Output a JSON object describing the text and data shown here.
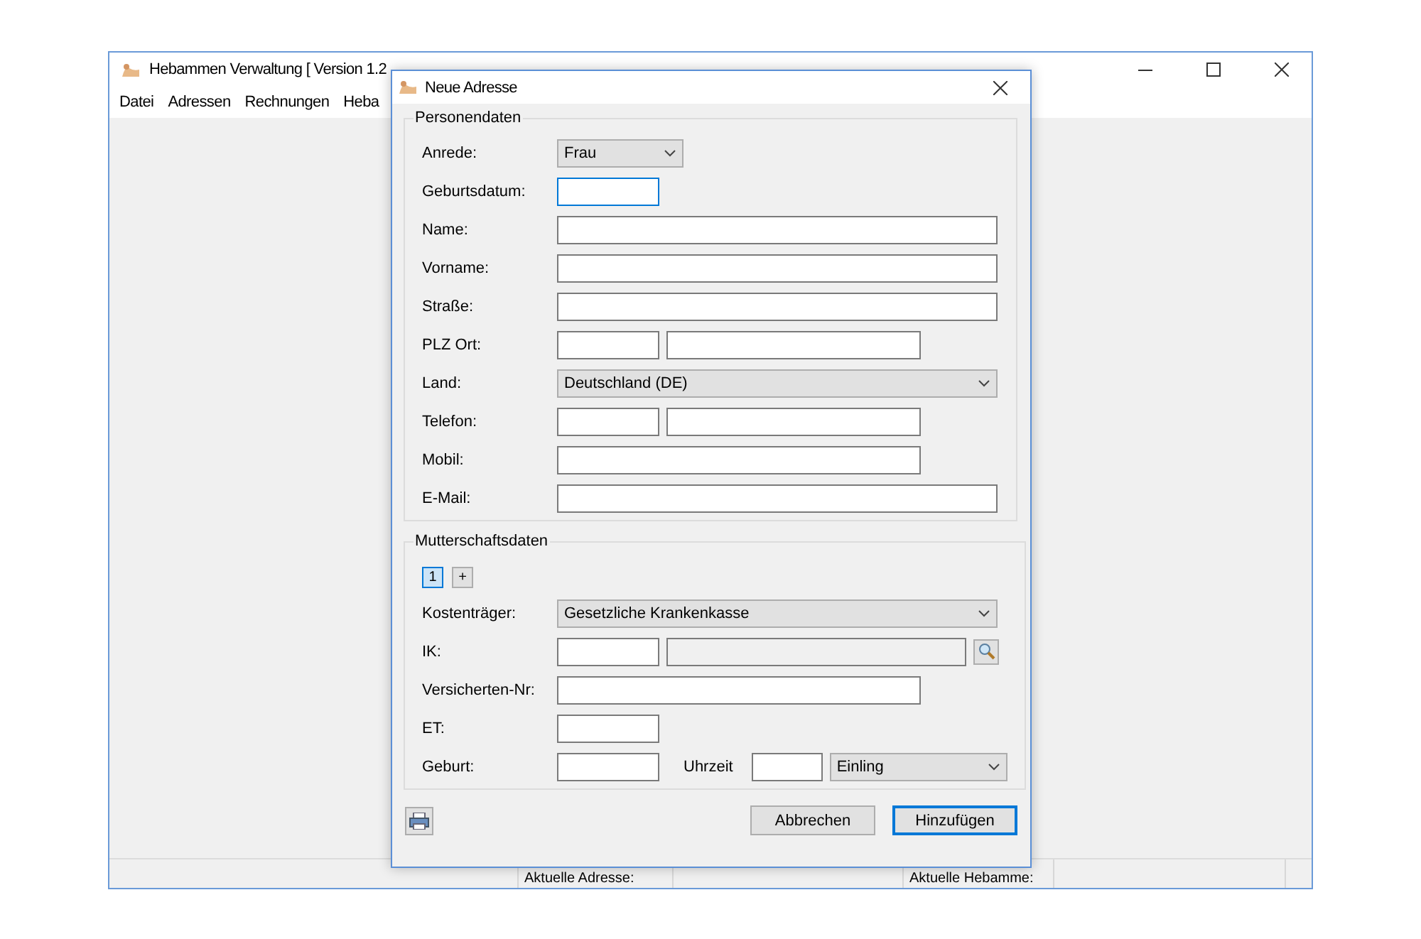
{
  "window": {
    "title": "Hebammen Verwaltung [ Version 1.2",
    "menu": [
      {
        "label": "Datei"
      },
      {
        "label": "Adressen"
      },
      {
        "label": "Rechnungen"
      },
      {
        "label": "Heba"
      }
    ]
  },
  "dialog": {
    "title": "Neue Adresse",
    "groups": [
      {
        "title": "Personendaten",
        "rows": [
          {
            "label": "Anrede:",
            "fields": [
              {
                "kind": "short-select",
                "value": "Frau"
              }
            ]
          },
          {
            "label": "Geburtsdatum:",
            "fields": [
              {
                "kind": "short-text",
                "focused": true
              }
            ]
          },
          {
            "label": "Name:",
            "fields": [
              {
                "kind": "text"
              }
            ]
          },
          {
            "label": "Vorname:",
            "fields": [
              {
                "kind": "text"
              }
            ]
          },
          {
            "label": "Straße:",
            "fields": [
              {
                "kind": "text"
              }
            ]
          },
          {
            "label": "PLZ Ort:",
            "fields": [
              {
                "kind": "short-text"
              },
              {
                "kind": "medium-text"
              }
            ]
          },
          {
            "label": "Land:",
            "fields": [
              {
                "kind": "select",
                "value": "Deutschland (DE)"
              }
            ]
          },
          {
            "label": "Telefon:",
            "fields": [
              {
                "kind": "short-text"
              },
              {
                "kind": "medium-text"
              }
            ]
          },
          {
            "label": "Mobil:",
            "fields": [
              {
                "kind": "long-text"
              }
            ]
          },
          {
            "label": "E-Mail:",
            "fields": [
              {
                "kind": "text"
              }
            ]
          }
        ]
      },
      {
        "title": "Mutterschaftsdaten",
        "tabs": [
          {
            "label": "1",
            "selected": true
          },
          {
            "label": "+",
            "selected": false
          }
        ],
        "rows": [
          {
            "label": "Kostenträger:",
            "fields": [
              {
                "kind": "select",
                "value": "Gesetzliche Krankenkasse"
              }
            ]
          },
          {
            "label": "IK:",
            "fields": [
              {
                "kind": "short-text"
              },
              {
                "kind": "readonly-text"
              },
              {
                "kind": "search-button"
              }
            ]
          },
          {
            "label": "Versicherten-Nr:",
            "fields": [
              {
                "kind": "long-text"
              }
            ]
          },
          {
            "label": "ET:",
            "fields": [
              {
                "kind": "short-text"
              }
            ]
          },
          {
            "label": "Geburt:",
            "fields": [
              {
                "kind": "short-text"
              },
              {
                "kind": "label",
                "text": "Uhrzeit"
              },
              {
                "kind": "time-text"
              },
              {
                "kind": "select",
                "value": "Einling"
              }
            ]
          }
        ]
      }
    ],
    "buttons": [
      {
        "label": "Abbrechen",
        "default": false
      },
      {
        "label": "Hinzufügen",
        "default": true
      }
    ]
  },
  "status_bar": [
    "Aktuelle Adresse:",
    "Aktuelle Hebamme:"
  ]
}
